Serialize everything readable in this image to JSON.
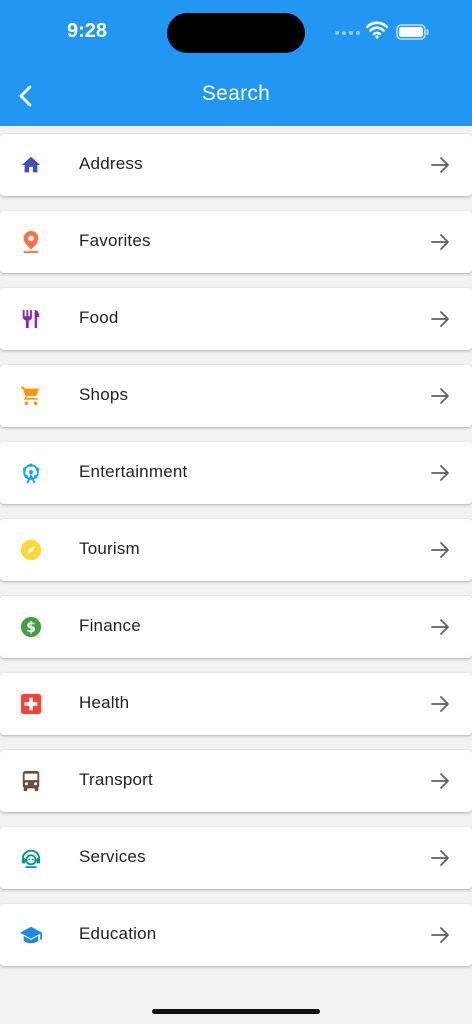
{
  "status_bar": {
    "time": "9:28"
  },
  "header": {
    "title": "Search"
  },
  "colors": {
    "header": "#2196f3",
    "address": "#3f51b5",
    "favorites": "#ff7043",
    "food": "#8e24aa",
    "shops": "#ff9800",
    "entertainment": "#03a9f4",
    "tourism": "#fdd835",
    "finance": "#43a047",
    "health": "#f44336",
    "transport": "#6d4c41",
    "services": "#009688",
    "education": "#1e88e5"
  },
  "categories": [
    {
      "label": "Address",
      "icon": "home-icon"
    },
    {
      "label": "Favorites",
      "icon": "location-pin-icon"
    },
    {
      "label": "Food",
      "icon": "restaurant-icon"
    },
    {
      "label": "Shops",
      "icon": "shopping-cart-icon"
    },
    {
      "label": "Entertainment",
      "icon": "ferris-wheel-icon"
    },
    {
      "label": "Tourism",
      "icon": "compass-icon"
    },
    {
      "label": "Finance",
      "icon": "dollar-icon"
    },
    {
      "label": "Health",
      "icon": "medical-cross-icon"
    },
    {
      "label": "Transport",
      "icon": "bus-icon"
    },
    {
      "label": "Services",
      "icon": "support-agent-icon"
    },
    {
      "label": "Education",
      "icon": "school-icon"
    }
  ]
}
